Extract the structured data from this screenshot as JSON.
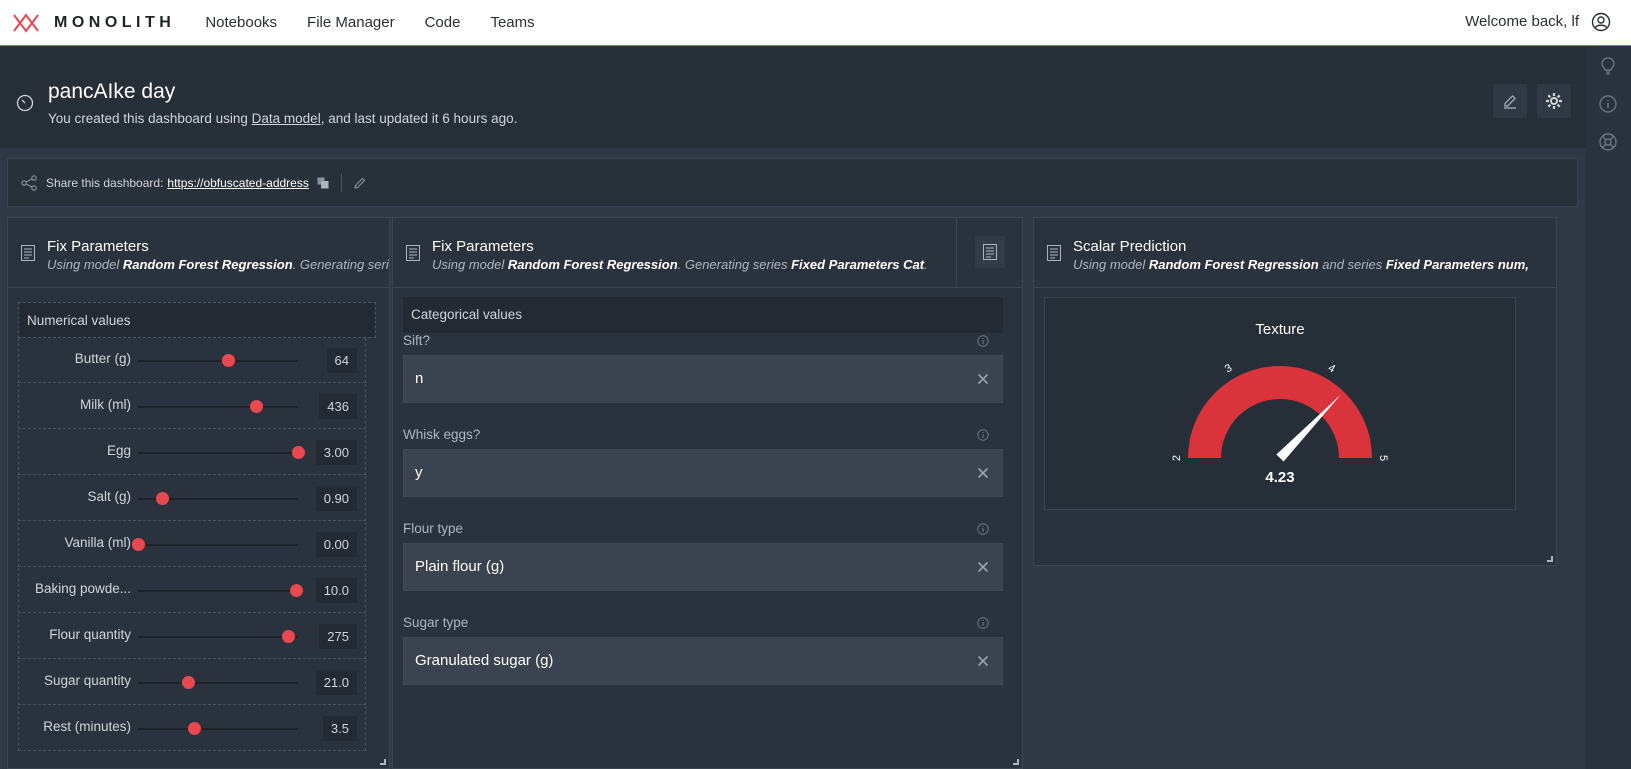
{
  "brand": {
    "name": "MONOLITH",
    "accent": "#e8484f"
  },
  "nav": {
    "items": [
      "Notebooks",
      "File Manager",
      "Code",
      "Teams"
    ]
  },
  "user": {
    "welcome": "Welcome back, lf"
  },
  "dashboard": {
    "title": "pancAIke day",
    "subtitle_pre": "You created this dashboard using ",
    "subtitle_link": "Data model",
    "subtitle_post": ", and last updated it 6 hours ago."
  },
  "share": {
    "label": "Share this dashboard:",
    "link": "https://obfuscated-address"
  },
  "panels": {
    "numerical": {
      "title": "Fix Parameters",
      "sub_pre": "Using model ",
      "model": "Random Forest Regression",
      "sub_mid": ". Generating seri",
      "section": "Numerical values",
      "rows": [
        {
          "label": "Butter (g)",
          "value": "64",
          "fraction": 0.56
        },
        {
          "label": "Milk (ml)",
          "value": "436",
          "fraction": 0.74
        },
        {
          "label": "Egg",
          "value": "3.00",
          "fraction": 1.0
        },
        {
          "label": "Salt (g)",
          "value": "0.90",
          "fraction": 0.15
        },
        {
          "label": "Vanilla (ml)",
          "value": "0.00",
          "fraction": 0.0
        },
        {
          "label": "Baking powde...",
          "value": "10.0",
          "fraction": 0.99
        },
        {
          "label": "Flour quantity",
          "value": "275",
          "fraction": 0.94
        },
        {
          "label": "Sugar quantity",
          "value": "21.0",
          "fraction": 0.31
        },
        {
          "label": "Rest (minutes)",
          "value": "3.5",
          "fraction": 0.35
        }
      ]
    },
    "categorical": {
      "title": "Fix Parameters",
      "sub_pre": "Using model ",
      "model": "Random Forest Regression",
      "sub_mid": ". Generating series ",
      "series": "Fixed Parameters Cat",
      "sub_post": ".",
      "section": "Categorical values",
      "fields": [
        {
          "label": "Sift?",
          "value": "n"
        },
        {
          "label": "Whisk eggs?",
          "value": "y"
        },
        {
          "label": "Flour type",
          "value": "Plain flour (g)"
        },
        {
          "label": "Sugar type",
          "value": "Granulated sugar (g)"
        }
      ]
    },
    "scalar": {
      "title": "Scalar Prediction",
      "sub_pre": "Using model ",
      "model": "Random Forest Regression",
      "sub_mid": " and series ",
      "series": "Fixed Parameters num,",
      "gauge": {
        "title": "Texture",
        "value": 4.23,
        "value_label": "4.23",
        "min": 2,
        "max": 5,
        "ticks": [
          "2",
          "3",
          "4",
          "5"
        ],
        "color": "#d9333b"
      }
    }
  }
}
